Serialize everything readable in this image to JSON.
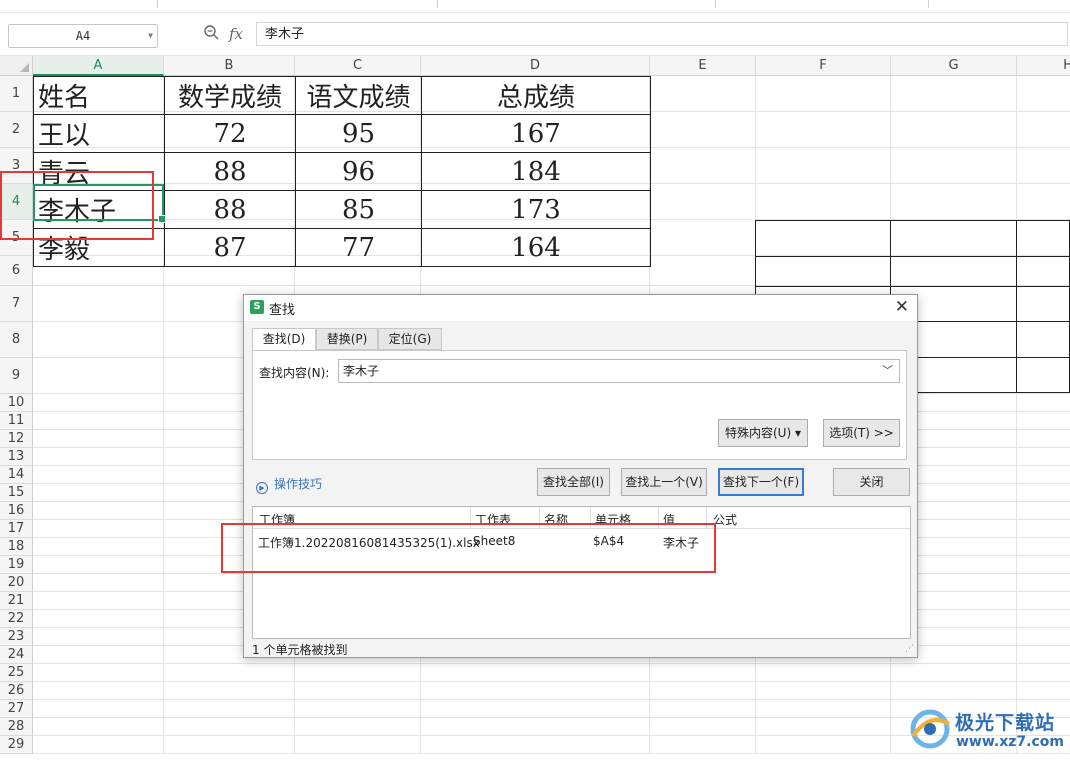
{
  "formula_bar": {
    "cell_ref": "A4",
    "formula_value": "李木子"
  },
  "columns": [
    "A",
    "B",
    "C",
    "D",
    "E",
    "F",
    "G",
    "H"
  ],
  "rows": [
    "1",
    "2",
    "3",
    "4",
    "5",
    "6",
    "7",
    "8",
    "9",
    "10",
    "11",
    "12",
    "13",
    "14",
    "15",
    "16",
    "17",
    "18",
    "19",
    "20",
    "21",
    "22",
    "23",
    "24",
    "25",
    "26",
    "27",
    "28",
    "29"
  ],
  "sheet_table": {
    "header": [
      "姓名",
      "数学成绩",
      "语文成绩",
      "总成绩"
    ],
    "rows": [
      [
        "王以",
        "72",
        "95",
        "167"
      ],
      [
        "青云",
        "88",
        "96",
        "184"
      ],
      [
        "李木子",
        "88",
        "85",
        "173"
      ],
      [
        "李毅",
        "87",
        "77",
        "164"
      ]
    ]
  },
  "dialog": {
    "title": "查找",
    "tabs": [
      "查找(D)",
      "替换(P)",
      "定位(G)"
    ],
    "find_label": "查找内容(N):",
    "find_value": "李木子",
    "special_button": "特殊内容(U) ▾",
    "options_button": "选项(T) >>",
    "tips_link": "操作技巧",
    "find_all_button": "查找全部(I)",
    "find_prev_button": "查找上一个(V)",
    "find_next_button": "查找下一个(F)",
    "close_button": "关闭",
    "result_columns": [
      "工作簿",
      "工作表",
      "名称",
      "单元格",
      "值",
      "公式"
    ],
    "result_rows": [
      {
        "workbook": "工作簿1.20220816081435325(1).xlsx",
        "sheet": "Sheet8",
        "name": "",
        "cell": "$A$4",
        "value": "李木子",
        "formula": ""
      }
    ],
    "status": "1 个单元格被找到"
  },
  "watermark": {
    "title": "极光下载站",
    "url": "www.xz7.com"
  },
  "colors": {
    "selection": "#1f9a63",
    "annotation": "#e53935",
    "link": "#3a74c0",
    "wps_logo": "#2fa05a"
  }
}
